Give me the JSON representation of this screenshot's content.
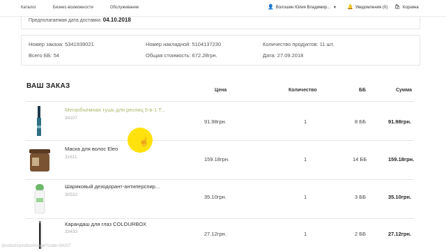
{
  "topbar": {
    "nav": [
      "Каталог",
      "Бизнес-возможности",
      "Обслуживание"
    ],
    "user_name": "Волошин Юлия Владимир...",
    "notifications": "Уведомления (0)",
    "cart": "Корзина"
  },
  "delivery": {
    "label": "Предполагаемая дата доставки:",
    "date": "04.10.2018"
  },
  "summary": {
    "order_number": "Номер заказа: 5341939021",
    "total_bb": "Всего ББ: 54",
    "invoice_number": "Номер накладной: 5104137230",
    "total_cost": "Общая стоимость: 672.28грн.",
    "product_count": "Количество продуктов: 11 шт.",
    "date": "Дата: 27.09.2018"
  },
  "order": {
    "title": "ВАШ ЗАКАЗ",
    "columns": {
      "price": "Цена",
      "quantity": "Количество",
      "bb": "ББ",
      "sum": "Сумма"
    },
    "rows": [
      {
        "name": "Мегаобъемная тушь для ресниц 5-в-1 Т...",
        "code": "34107",
        "price": "91.98грн.",
        "qty": "1",
        "bb": "8 ББ",
        "sum": "91.98грн."
      },
      {
        "name": "Маска для волос Eleo",
        "code": "31611",
        "price": "159.18грн.",
        "qty": "1",
        "bb": "14 ББ",
        "sum": "159.18грн."
      },
      {
        "name": "Шариковый дезодорант-антиперспир...",
        "code": "30532",
        "price": "35.10грн.",
        "qty": "1",
        "bb": "3 ББ",
        "sum": "35.10грн."
      },
      {
        "name": "Карандаш для глаз COLOURBOX",
        "code": "33433",
        "price": "27.12грн.",
        "qty": "1",
        "bb": "2 ББ",
        "sum": "27.12грн."
      }
    ]
  },
  "status_url": "/products/productImage?code=34107",
  "colors": {
    "highlight_link": "#a8b86a",
    "cursor_highlight": "#ffe000"
  }
}
